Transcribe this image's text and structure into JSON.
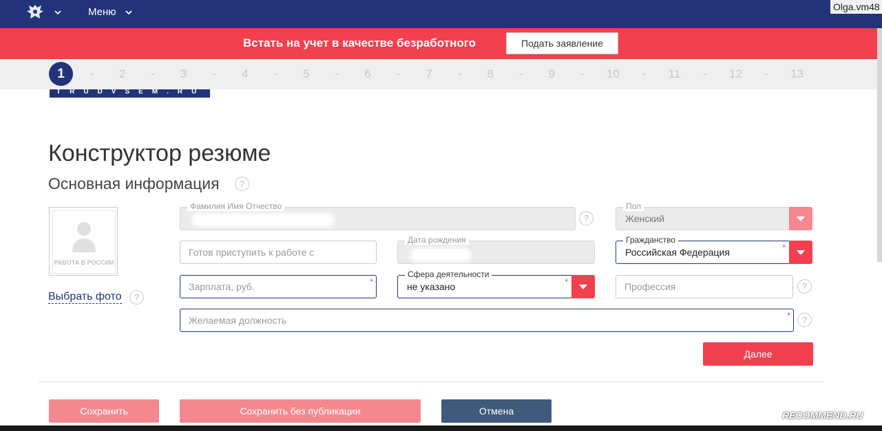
{
  "header": {
    "menu_label": "Меню",
    "username": "Olga.vm48",
    "colors": {
      "nav": "#22337a",
      "accent": "#f2404f"
    }
  },
  "banner": {
    "title": "Встать на учет в качестве безработного",
    "apply_label": "Подать заявление"
  },
  "steps": {
    "active": "1",
    "items": [
      "2",
      "3",
      "4",
      "5",
      "6",
      "7",
      "8",
      "9",
      "10",
      "11",
      "12",
      "13"
    ],
    "separator": "-"
  },
  "logo_text": "TRUDVSEM.RU",
  "page_title": "Конструктор резюме",
  "section_title": "Основная информация",
  "help_glyph": "?",
  "photo": {
    "caption": "РАБОТА В РОССИИ",
    "choose_label": "Выбрать фото"
  },
  "form": {
    "fio_label": "Фамилия Имя Отчество",
    "gender_label": "Пол",
    "gender_value": "Женский",
    "ready_placeholder": "Готов приступить к работе с",
    "birth_label": "Дата рождения",
    "citizenship_label": "Гражданство",
    "citizenship_value": "Российская Федерация",
    "salary_placeholder": "Зарплата, руб.",
    "sphere_label": "Сфера деятельности",
    "sphere_value": "не указано",
    "profession_placeholder": "Профессия",
    "position_placeholder": "Желаемая должность",
    "required_mark": "*"
  },
  "buttons": {
    "next": "Далее",
    "save": "Сохранить",
    "save_no_publish": "Сохранить без публикации",
    "cancel": "Отмена"
  },
  "watermark": "RECOMMEND.RU"
}
